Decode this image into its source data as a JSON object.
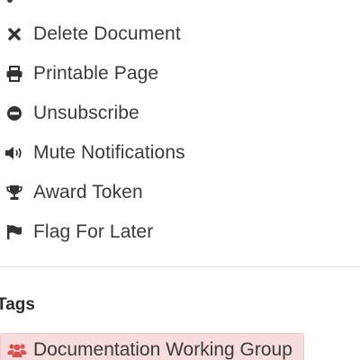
{
  "actions": [
    {
      "id": "delete",
      "label": "Delete Document",
      "icon": "times-icon"
    },
    {
      "id": "print",
      "label": "Printable Page",
      "icon": "print-icon"
    },
    {
      "id": "unsubscribe",
      "label": "Unsubscribe",
      "icon": "minus-circle-icon"
    },
    {
      "id": "mute",
      "label": "Mute Notifications",
      "icon": "volume-icon"
    },
    {
      "id": "award",
      "label": "Award Token",
      "icon": "trophy-icon"
    },
    {
      "id": "flag",
      "label": "Flag For Later",
      "icon": "flag-icon"
    }
  ],
  "tags": {
    "heading": "Tags",
    "items": [
      {
        "label": "Documentation Working Group",
        "icon": "users-icon",
        "background": "#f6dcdc",
        "icon_color": "#d9534f"
      }
    ]
  },
  "colors": {
    "text": "#3b3b3b",
    "icon": "#333333",
    "tag_background": "#f6dcdc",
    "tag_icon": "#d9534f"
  }
}
